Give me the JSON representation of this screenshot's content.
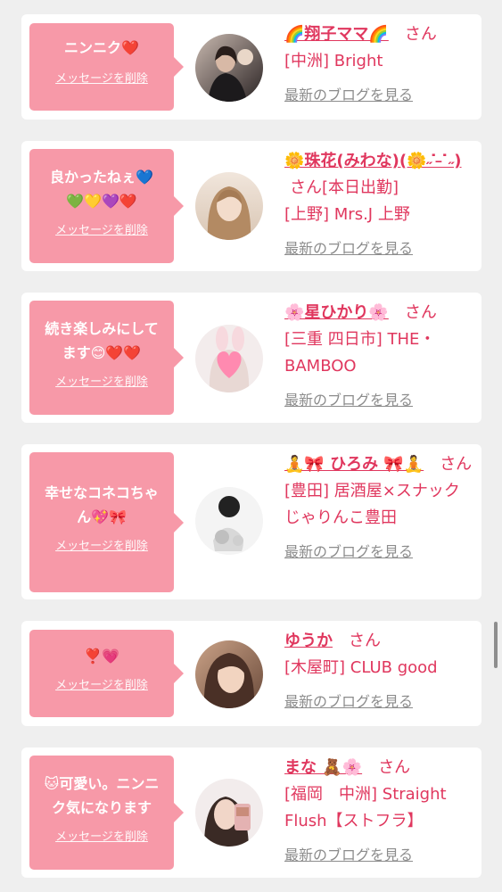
{
  "cards": [
    {
      "message": "ニンニク❤️",
      "delete_label": "メッセージを削除",
      "avatar": "avatar-photo-1",
      "name": "🌈翔子ママ🌈",
      "san": "さん",
      "shop": "[中洲] Bright",
      "blog_link": "最新のブログを見る"
    },
    {
      "message": "良かったねぇ💙\n💚💛💜❤️",
      "delete_label": "メッセージを削除",
      "avatar": "avatar-photo-2",
      "name": "🌼珠花(みわな)(🌼˶ ̇ ̵ ̇˶)",
      "san": "さん[本日出勤]",
      "shop": "[上野] Mrs.J 上野",
      "blog_link": "最新のブログを見る"
    },
    {
      "message": "続き楽しみにして\nます😊❤️❤️",
      "delete_label": "メッセージを削除",
      "avatar": "avatar-photo-3",
      "name": "🌸星ひかり🌸",
      "san": "さん",
      "shop": "[三重 四日市] THE・BAMBOO",
      "blog_link": "最新のブログを見る"
    },
    {
      "message": "幸せなコネコちゃ\nん💖🎀",
      "delete_label": "メッセージを削除",
      "avatar": "avatar-photo-4",
      "name": "🧘🎀 ひろみ 🎀🧘",
      "san": "さん",
      "shop": "[豊田] 居酒屋×スナックじゃりんこ豊田",
      "blog_link": "最新のブログを見る"
    },
    {
      "message": "❣️💗",
      "delete_label": "メッセージを削除",
      "avatar": "avatar-photo-5",
      "name": "ゆうか",
      "san": "さん",
      "shop": "[木屋町] CLUB good",
      "blog_link": "最新のブログを見る"
    },
    {
      "message": "🐱可愛い。ニンニ\nク気になります",
      "delete_label": "メッセージを削除",
      "avatar": "avatar-photo-6",
      "name": "まな 🧸🌸",
      "san": "さん",
      "shop": "[福岡　中洲] Straight Flush【ストフラ】",
      "blog_link": "最新のブログを見る"
    }
  ],
  "colors": {
    "bubble": "#f799a8",
    "name": "#e0375e",
    "link_gray": "#8c8c8c",
    "background": "#efefef"
  }
}
